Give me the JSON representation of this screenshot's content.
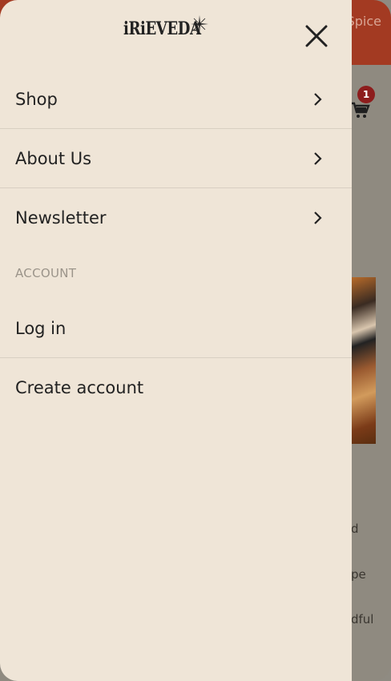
{
  "background": {
    "banner_text": "Spice",
    "cart_count": "1",
    "text_lines": [
      "d",
      "pe",
      "dful"
    ]
  },
  "drawer": {
    "logo_text": "iRiEVEDA",
    "nav": [
      {
        "label": "Shop"
      },
      {
        "label": "About Us"
      },
      {
        "label": "Newsletter"
      }
    ],
    "account_section_label": "ACCOUNT",
    "account_links": [
      {
        "label": "Log in"
      },
      {
        "label": "Create account"
      }
    ]
  },
  "icons": {
    "close": "close-icon",
    "chevron": "chevron-right-icon",
    "cart": "cart-icon"
  },
  "colors": {
    "drawer_bg": "#efe5d7",
    "banner": "#a33a22",
    "badge": "#8d1d1d",
    "overlay": "#8f8a80"
  }
}
